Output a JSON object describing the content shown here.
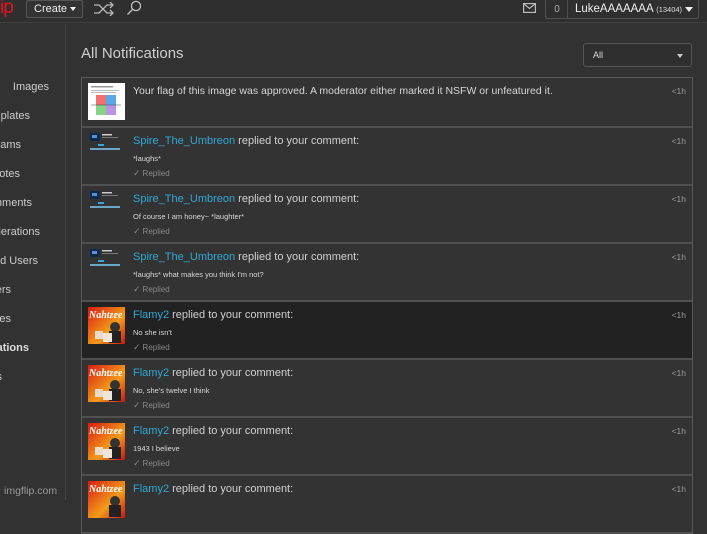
{
  "header": {
    "logo_fragment": "ip",
    "create_label": "Create",
    "notification_count": "0",
    "username": "LukeAAAAAAA",
    "user_points": "(13404)",
    "icons": [
      "shuffle-icon",
      "search-icon",
      "mail-icon"
    ]
  },
  "sidebar": {
    "items": [
      {
        "label": "Images"
      },
      {
        "label": "Templates"
      },
      {
        "label": "Streams"
      },
      {
        "label": "Upvotes"
      },
      {
        "label": "Comments"
      },
      {
        "label": "Moderations"
      },
      {
        "label": "Followed Users"
      },
      {
        "label": "Followers"
      },
      {
        "label": "Invites"
      },
      {
        "label": "Notifications"
      },
      {
        "label": "Stats"
      }
    ],
    "footer": "imgflip.com"
  },
  "main": {
    "title": "All Notifications",
    "filter": {
      "selected": "All"
    },
    "notifications": [
      {
        "type": "flag",
        "text": "Your flag of this image was approved. A moderator either marked it NSFW or unfeatured it.",
        "time": "<1h"
      },
      {
        "type": "reply",
        "user": "Spire_The_Umbreon",
        "action": " replied to your comment:",
        "comment": "*laughs*",
        "status": "Replied",
        "time": "<1h"
      },
      {
        "type": "reply",
        "user": "Spire_The_Umbreon",
        "action": " replied to your comment:",
        "comment": "Of course I am honey~ *laughter*",
        "status": "Replied",
        "time": "<1h"
      },
      {
        "type": "reply",
        "user": "Spire_The_Umbreon",
        "action": " replied to your comment:",
        "comment": "*laughs* what makes you think I'm not?",
        "status": "Replied",
        "time": "<1h"
      },
      {
        "type": "reply",
        "user": "Flamy2",
        "action": " replied to your comment:",
        "comment": "No she isn't",
        "status": "Replied",
        "time": "<1h"
      },
      {
        "type": "reply",
        "user": "Flamy2",
        "action": " replied to your comment:",
        "comment": "No, she's twelve I think",
        "status": "Replied",
        "time": "<1h"
      },
      {
        "type": "reply",
        "user": "Flamy2",
        "action": " replied to your comment:",
        "comment": "1943 I believe",
        "status": "Replied",
        "time": "<1h"
      },
      {
        "type": "reply",
        "user": "Flamy2",
        "action": " replied to your comment:",
        "comment": "",
        "status": "",
        "time": "<1h"
      }
    ]
  },
  "colors": {
    "accent_link": "#2ea8d6",
    "logo_red": "#e2141e",
    "background": "#323232"
  }
}
